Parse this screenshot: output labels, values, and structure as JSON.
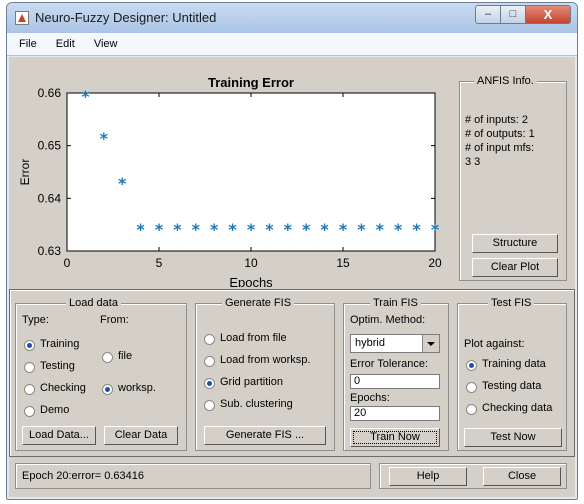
{
  "window": {
    "title": "Neuro-Fuzzy Designer: Untitled"
  },
  "menu": {
    "file": "File",
    "edit": "Edit",
    "view": "View"
  },
  "chart_data": {
    "type": "scatter",
    "title": "Training Error",
    "xlabel": "Epochs",
    "ylabel": "Error",
    "xlim": [
      0,
      20
    ],
    "ylim": [
      0.63,
      0.66
    ],
    "xticks": [
      "0",
      "5",
      "10",
      "15",
      "20"
    ],
    "yticks": [
      "0.63",
      "0.64",
      "0.65",
      "0.66"
    ],
    "marker": "*",
    "color": "#1f77b4",
    "grid": false,
    "x": [
      1,
      2,
      3,
      4,
      5,
      6,
      7,
      8,
      9,
      10,
      11,
      12,
      13,
      14,
      15,
      16,
      17,
      18,
      19,
      20
    ],
    "y": [
      0.6594,
      0.6515,
      0.6429,
      0.6342,
      0.6342,
      0.6342,
      0.6342,
      0.6342,
      0.6342,
      0.6342,
      0.6342,
      0.6342,
      0.6342,
      0.6342,
      0.6342,
      0.6342,
      0.6342,
      0.6342,
      0.6342,
      0.6342
    ]
  },
  "anfis": {
    "title": "ANFIS Info.",
    "inputs": "# of inputs: 2",
    "outputs": "# of outputs: 1",
    "mfs_label": "# of input mfs:",
    "mfs_value": "3 3",
    "structure_button": "Structure",
    "clear_plot_button": "Clear Plot"
  },
  "load_data": {
    "title": "Load data",
    "type_label": "Type:",
    "from_label": "From:",
    "type_options": [
      "Training",
      "Testing",
      "Checking",
      "Demo"
    ],
    "type_selected": "Training",
    "from_options": [
      "file",
      "worksp."
    ],
    "from_selected": "worksp.",
    "load_button": "Load Data...",
    "clear_button": "Clear Data"
  },
  "generate_fis": {
    "title": "Generate FIS",
    "options": [
      "Load from file",
      "Load from worksp.",
      "Grid partition",
      "Sub. clustering"
    ],
    "selected": "Grid partition",
    "button": "Generate FIS ..."
  },
  "train_fis": {
    "title": "Train FIS",
    "method_label": "Optim. Method:",
    "method_value": "hybrid",
    "tolerance_label": "Error Tolerance:",
    "tolerance_value": "0",
    "epochs_label": "Epochs:",
    "epochs_value": "20",
    "button": "Train Now"
  },
  "test_fis": {
    "title": "Test FIS",
    "plot_against_label": "Plot against:",
    "options": [
      "Training data",
      "Testing data",
      "Checking data"
    ],
    "selected": "Training data",
    "button": "Test Now"
  },
  "status": {
    "text": "Epoch 20:error= 0.63416"
  },
  "footer": {
    "help_button": "Help",
    "close_button": "Close"
  }
}
